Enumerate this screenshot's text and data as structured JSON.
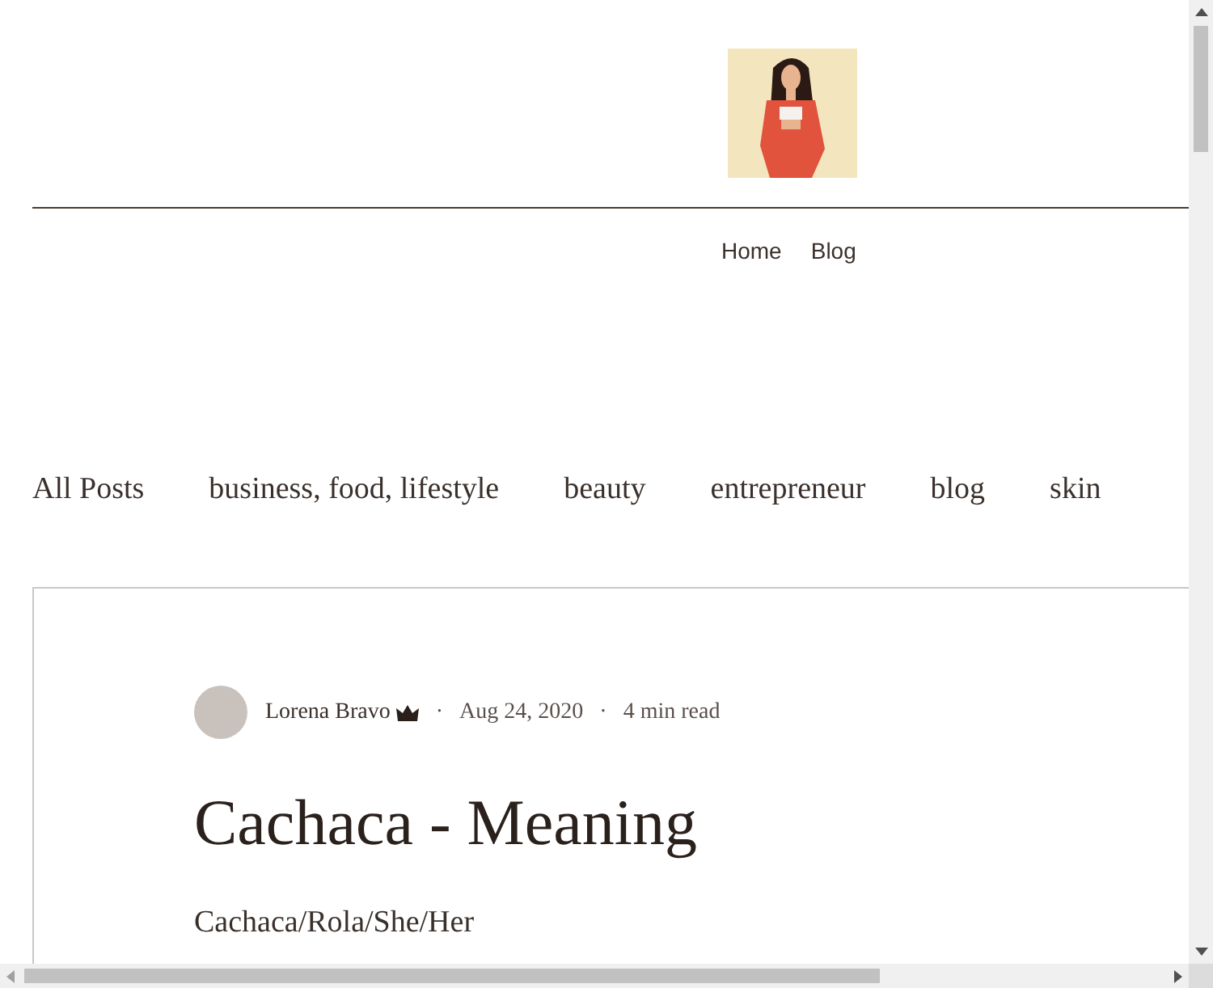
{
  "header": {
    "nav": [
      {
        "label": "Home"
      },
      {
        "label": "Blog"
      }
    ]
  },
  "categories": [
    {
      "label": "All Posts"
    },
    {
      "label": "business, food, lifestyle"
    },
    {
      "label": "beauty"
    },
    {
      "label": "entrepreneur"
    },
    {
      "label": "blog"
    },
    {
      "label": "skin"
    }
  ],
  "post": {
    "author": "Lorena Bravo",
    "admin": true,
    "separators": [
      "·",
      "·"
    ],
    "date": "Aug 24, 2020",
    "read_time": "4 min read",
    "title": "Cachaca - Meaning",
    "excerpt": "Cachaca/Rola/She/Her"
  }
}
